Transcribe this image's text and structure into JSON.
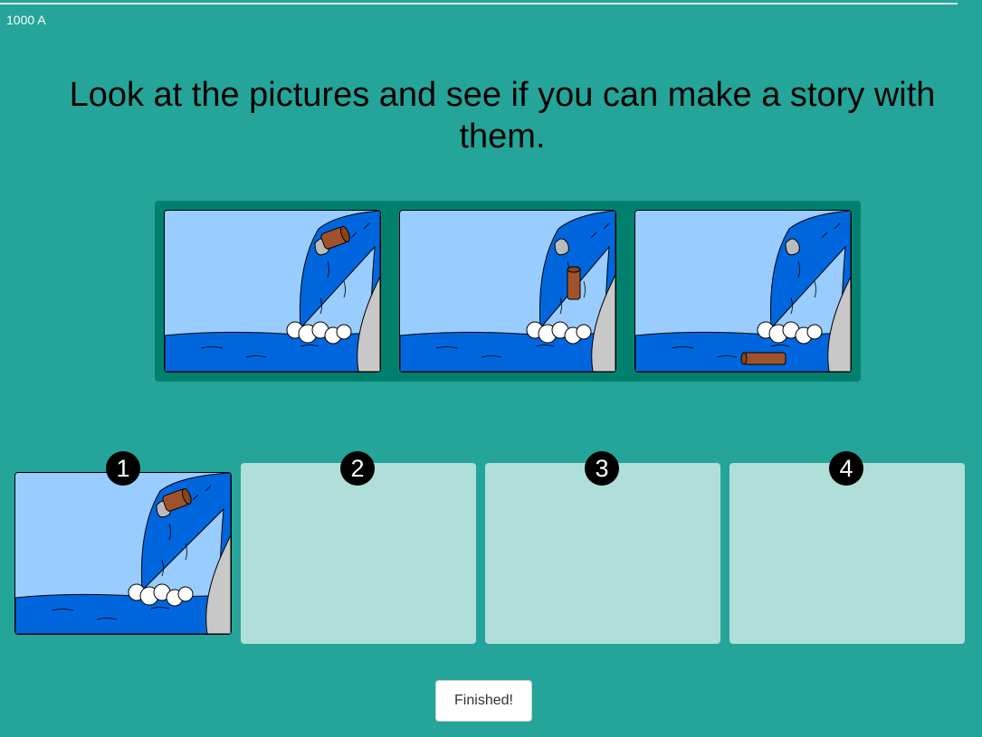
{
  "header": {
    "code": "1000 A"
  },
  "instruction": "Look at the pictures and see if you can make a story with them.",
  "slots": [
    {
      "number": "1"
    },
    {
      "number": "2"
    },
    {
      "number": "3"
    },
    {
      "number": "4"
    }
  ],
  "finish_button": {
    "label": "Finished!"
  },
  "colors": {
    "background": "#25a599",
    "tray": "#02806e",
    "slot": "#b0dfda",
    "sky": "#99ccff",
    "water": "#0066dd",
    "rock": "#c8c8c8",
    "log": "#a0522d"
  },
  "cards": [
    {
      "scene": "log-at-top-of-waterfall"
    },
    {
      "scene": "log-falling-down-waterfall"
    },
    {
      "scene": "log-floating-at-bottom-of-waterfall"
    },
    {
      "scene": "log-at-top-of-waterfall"
    }
  ]
}
